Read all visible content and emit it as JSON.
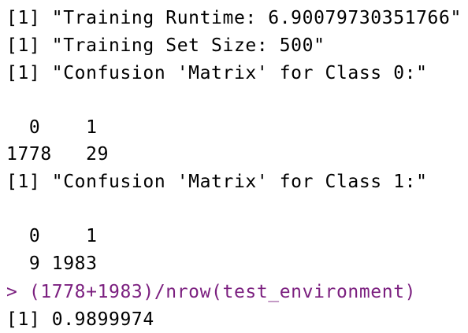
{
  "console": {
    "lines": [
      "[1] \"Training Runtime: 6.90079730351766\"",
      "[1] \"Training Set Size: 500\"",
      "[1] \"Confusion 'Matrix' for Class 0:\"",
      "  0    1",
      "1778   29",
      "[1] \"Confusion 'Matrix' for Class 1:\"",
      "  0    1",
      "  9 1983",
      "> (1778+1983)/nrow(test_environment)",
      "[1] 0.9899974"
    ]
  },
  "colors": {
    "output": "#000000",
    "command": "#7b1f7f",
    "background": "#ffffff"
  }
}
